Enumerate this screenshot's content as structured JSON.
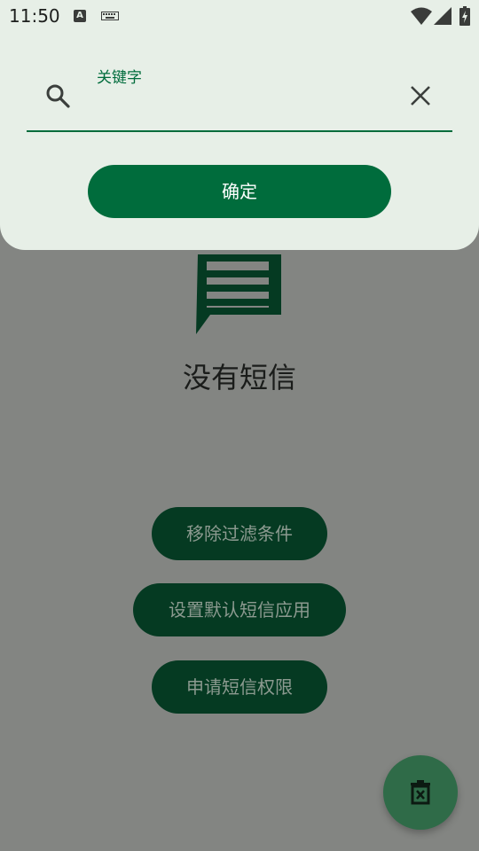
{
  "status_bar": {
    "time": "11:50",
    "notification_icon": "A",
    "icons": [
      "keyboard-icon",
      "wifi-icon",
      "signal-icon",
      "battery-charging-icon"
    ]
  },
  "search": {
    "label": "关键字",
    "value": "",
    "placeholder": "",
    "confirm_label": "确定"
  },
  "empty_state": {
    "icon": "message-icon",
    "text": "没有短信"
  },
  "actions": {
    "remove_filter": "移除过滤条件",
    "set_default": "设置默认短信应用",
    "request_permission": "申请短信权限"
  },
  "fab": {
    "icon": "delete-icon"
  },
  "colors": {
    "primary": "#006c3c",
    "sheet_bg": "#e7efe7",
    "scrim_bg": "#838582",
    "dim_button": "#053a22"
  }
}
